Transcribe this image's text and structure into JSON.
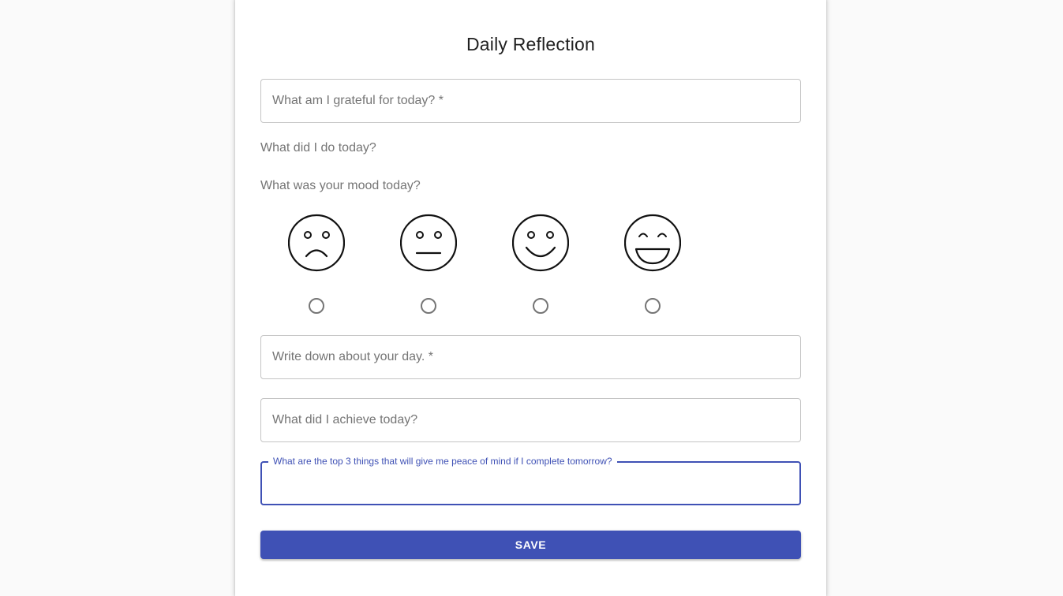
{
  "form": {
    "title": "Daily Reflection",
    "grateful_placeholder": "What am I grateful for today? *",
    "did_today_label": "What did I do today?",
    "mood_label": "What was your mood today?",
    "moods": [
      {
        "icon": "sad-face-icon"
      },
      {
        "icon": "neutral-face-icon"
      },
      {
        "icon": "smile-face-icon"
      },
      {
        "icon": "laughing-face-icon"
      }
    ],
    "day_placeholder": "Write down about your day. *",
    "achieve_placeholder": "What did I achieve today?",
    "top3_label": "What are the top 3 things that will give me peace of mind if I complete tomorrow?",
    "top3_value": "",
    "save_label": "SAVE"
  },
  "colors": {
    "primary": "#3f51b5",
    "background": "#fafafa",
    "card": "#ffffff"
  }
}
